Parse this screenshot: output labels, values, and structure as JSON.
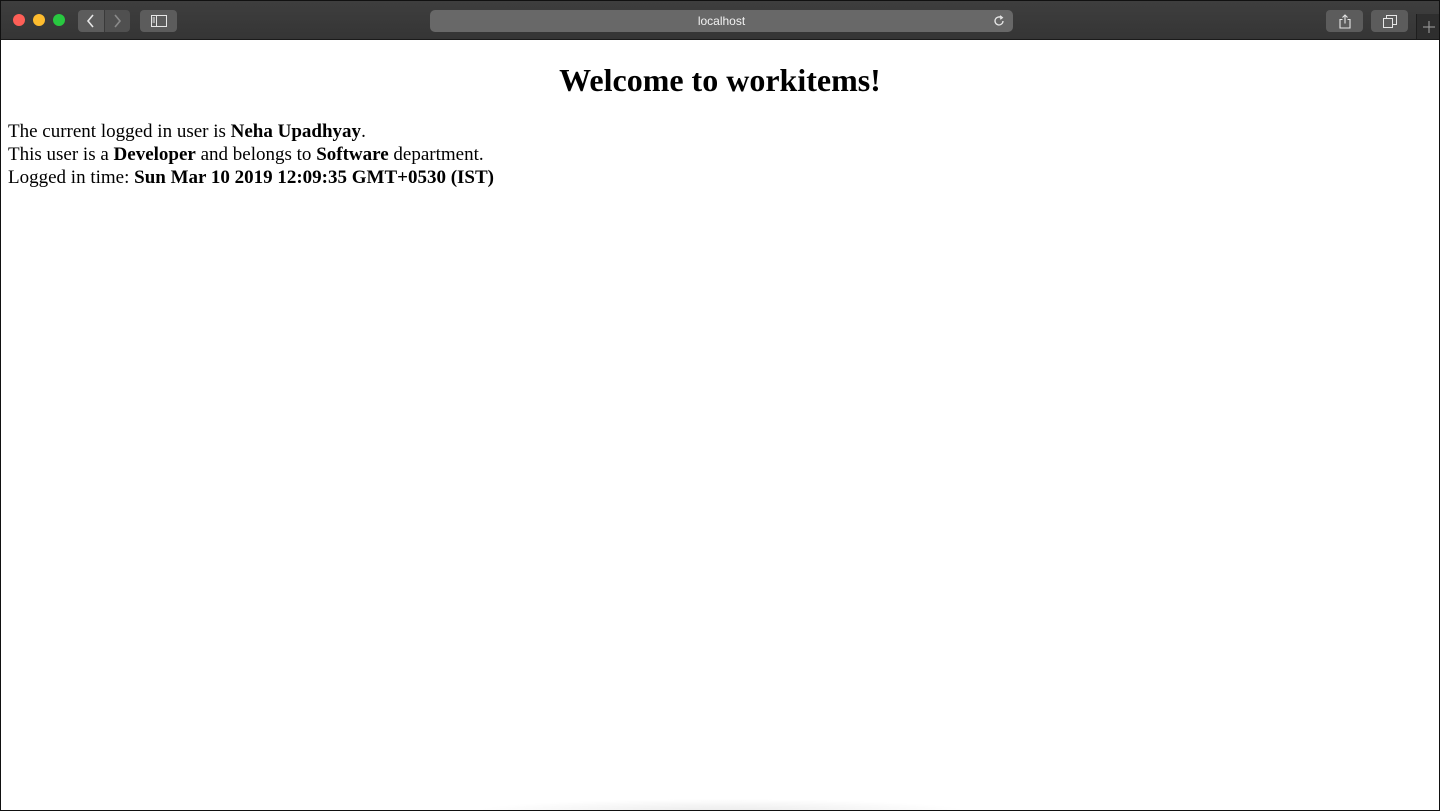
{
  "browser": {
    "address": "localhost",
    "icons": {
      "back": "chevron-left-icon",
      "forward": "chevron-right-icon",
      "sidebar": "sidebar-icon",
      "reload": "reload-icon",
      "share": "share-icon",
      "tabs": "tabs-overview-icon",
      "new_tab": "plus-icon"
    },
    "colors": {
      "close": "#fe5f57",
      "minimize": "#febc2e",
      "maximize": "#28c840"
    }
  },
  "page": {
    "heading": "Welcome to workitems!",
    "line1": {
      "prefix": "The current logged in user is ",
      "user_name": "Neha Upadhyay",
      "suffix": "."
    },
    "line2": {
      "prefix": "This user is a ",
      "role": "Developer",
      "middle": " and belongs to ",
      "department": "Software",
      "suffix": " department."
    },
    "line3": {
      "prefix": "Logged in time: ",
      "time": "Sun Mar 10 2019 12:09:35 GMT+0530 (IST)"
    }
  }
}
